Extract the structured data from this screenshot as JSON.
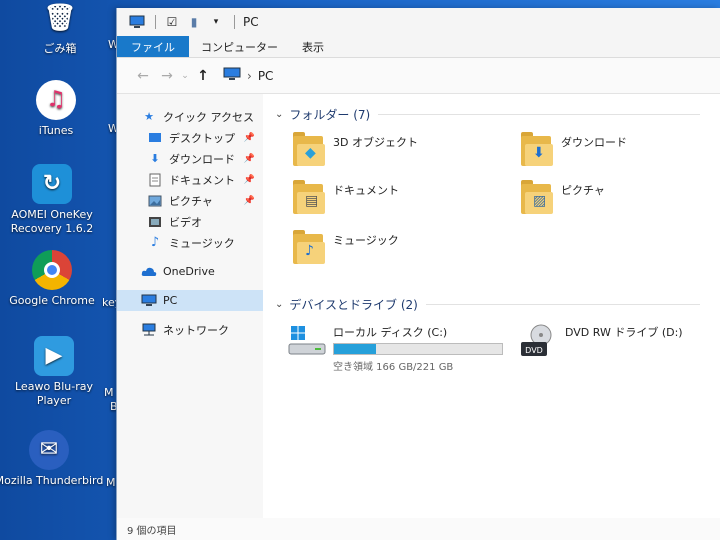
{
  "desktop": {
    "icons": [
      {
        "label": "ごみ箱",
        "icon": "recycle-bin-icon"
      },
      {
        "label": "iTunes",
        "icon": "itunes-icon"
      },
      {
        "label": "AOMEI OneKey Recovery 1.6.2",
        "icon": "aomei-icon"
      },
      {
        "label": "Google Chrome",
        "icon": "chrome-icon"
      },
      {
        "label": "Leawo Blu-ray Player",
        "icon": "leawo-icon"
      },
      {
        "label": "Mozilla Thunderbird",
        "icon": "thunderbird-icon"
      }
    ],
    "partial_labels": [
      "Wi",
      "Wi",
      "key",
      "M",
      "B",
      "M"
    ]
  },
  "window": {
    "title": "PC",
    "ribbon_tabs": [
      "ファイル",
      "コンピューター",
      "表示"
    ],
    "address": {
      "path": "PC"
    },
    "nav": {
      "quick_access": "クイック アクセス",
      "quick_items": [
        {
          "label": "デスクトップ",
          "icon": "desktop-icon",
          "pinned": true
        },
        {
          "label": "ダウンロード",
          "icon": "download-icon",
          "pinned": true
        },
        {
          "label": "ドキュメント",
          "icon": "document-icon",
          "pinned": true
        },
        {
          "label": "ピクチャ",
          "icon": "picture-icon",
          "pinned": true
        },
        {
          "label": "ビデオ",
          "icon": "video-icon",
          "pinned": false
        },
        {
          "label": "ミュージック",
          "icon": "music-icon",
          "pinned": false
        }
      ],
      "onedrive": "OneDrive",
      "pc": "PC",
      "network": "ネットワーク"
    },
    "folders_header": "フォルダー (7)",
    "folders": [
      {
        "name": "3D オブジェクト",
        "icon": "3d-objects-icon"
      },
      {
        "name": "ダウンロード",
        "icon": "download-icon"
      },
      {
        "name": "ドキュメント",
        "icon": "document-icon"
      },
      {
        "name": "ピクチャ",
        "icon": "picture-icon"
      },
      {
        "name": "ミュージック",
        "icon": "music-icon"
      }
    ],
    "drives_header": "デバイスとドライブ (2)",
    "drives": [
      {
        "name": "ローカル ディスク (C:)",
        "free_text": "空き領域 166 GB/221 GB",
        "used_fraction": 0.25,
        "icon": "hdd-icon"
      },
      {
        "name": "DVD RW ドライブ (D:)",
        "icon": "dvd-drive-icon"
      }
    ],
    "status": "9 個の項目"
  }
}
